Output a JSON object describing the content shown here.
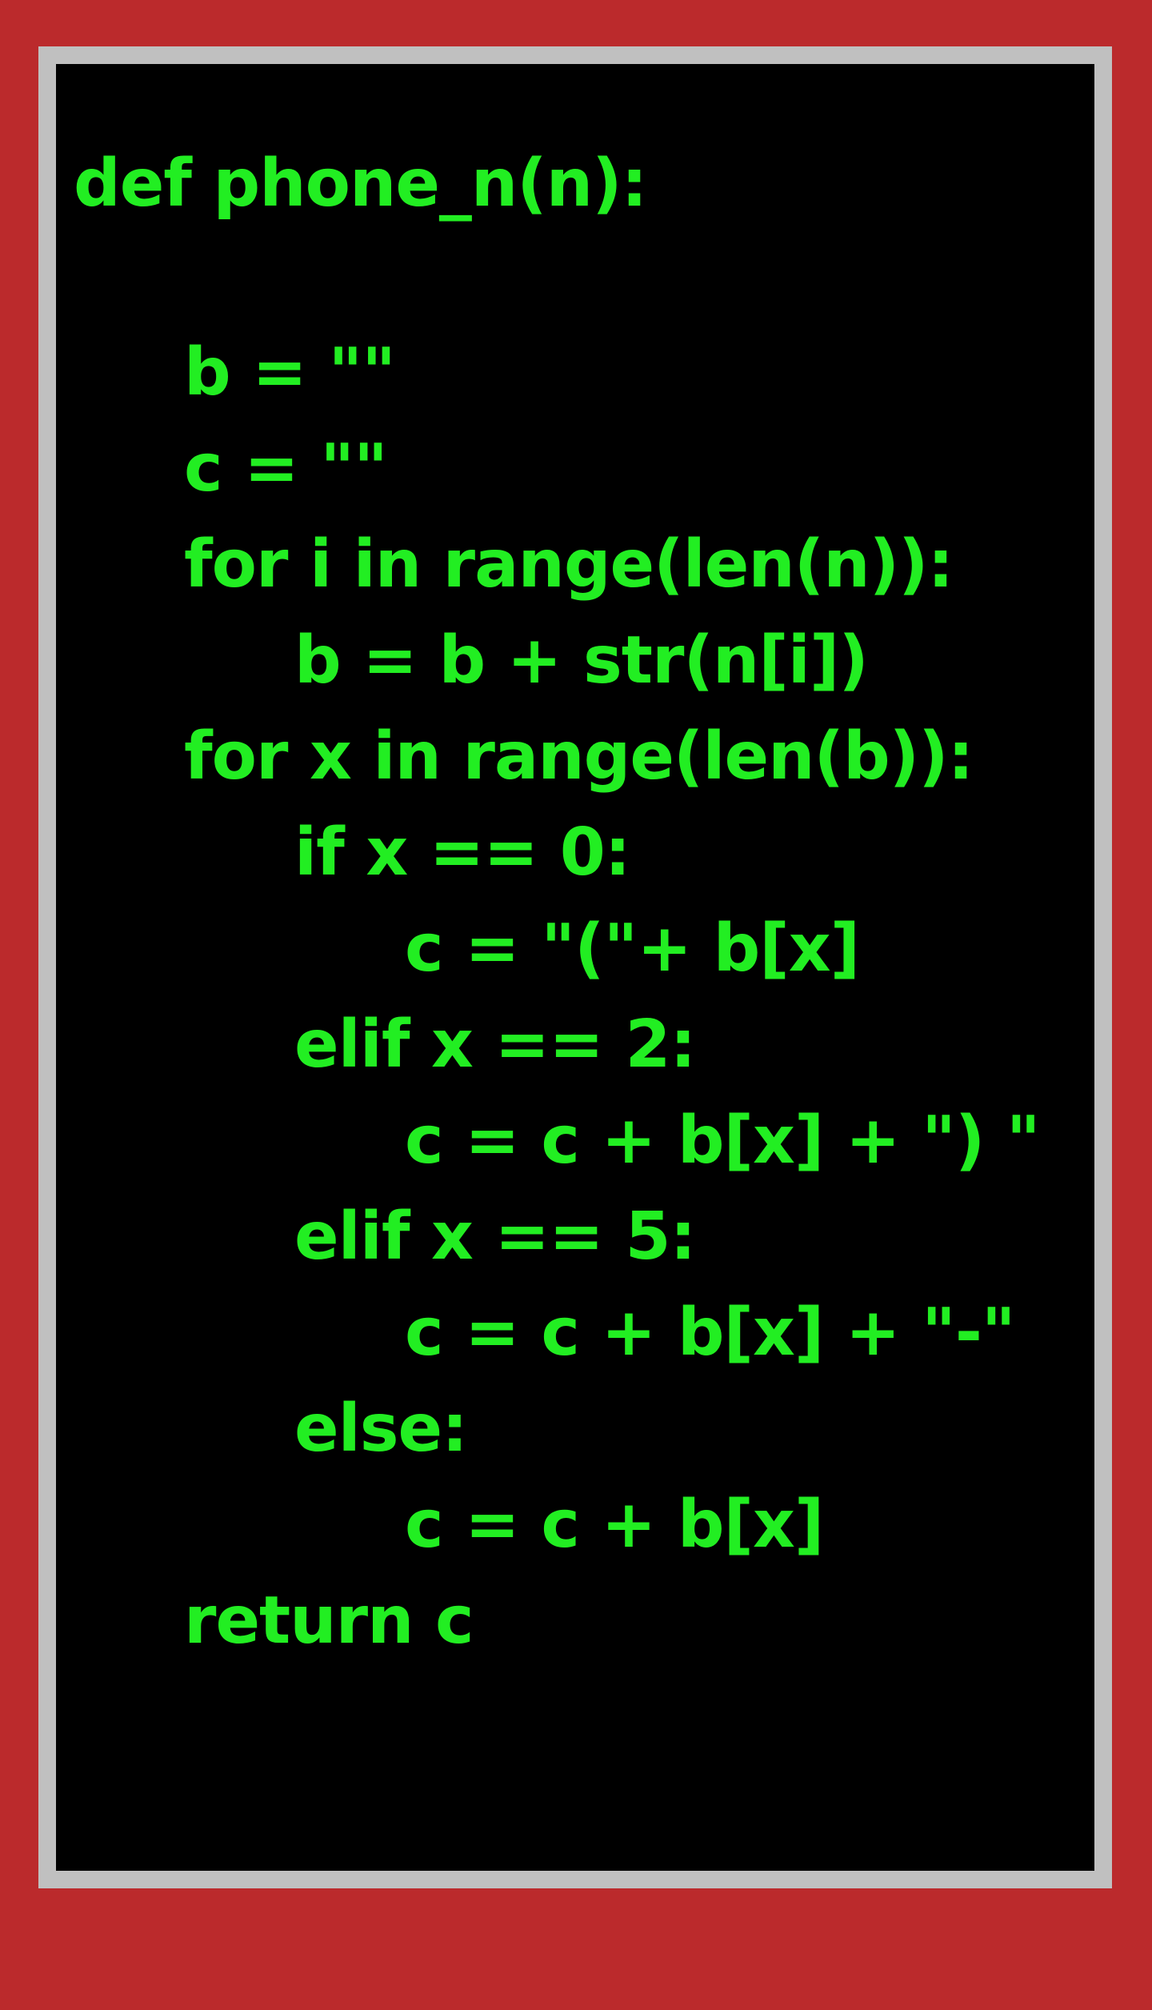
{
  "colors": {
    "background": "#bb2a2c",
    "bezel": "#c0c0c0",
    "screen": "#000000",
    "code_text": "#22ee22"
  },
  "code": {
    "lines": [
      "def phone_n(n):",
      "",
      "b = \"\"",
      "c = \"\"",
      "for i in range(len(n)):",
      "b = b + str(n[i])",
      "for x in range(len(b)):",
      "if x == 0:",
      "c = \"(\"+ b[x]",
      "elif x == 2:",
      "c = c + b[x] + \") \"",
      "elif x == 5:",
      "c = c + b[x] + \"-\"",
      "else:",
      "c = c + b[x]",
      "return c"
    ]
  }
}
